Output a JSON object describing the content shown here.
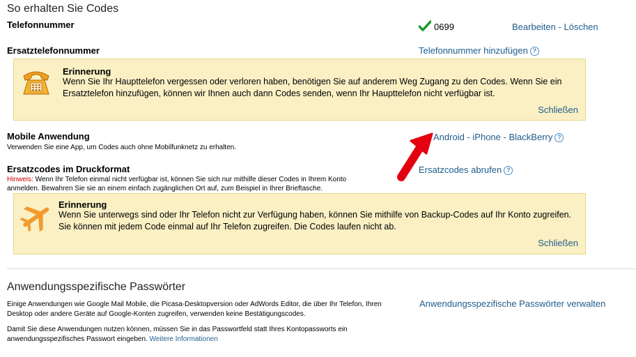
{
  "header": {
    "title": "So erhalten Sie Codes"
  },
  "phone": {
    "label": "Telefonnummer",
    "number": "0699",
    "edit": "Bearbeiten",
    "sep": "-",
    "delete": "Löschen"
  },
  "backup_phone": {
    "label": "Ersatztelefonnummer",
    "add_link": "Telefonnummer hinzufügen",
    "reminder": {
      "title": "Erinnerung",
      "text": "Wenn Sie Ihr Haupttelefon vergessen oder verloren haben, benötigen Sie auf anderem Weg Zugang zu den Codes. Wenn Sie ein Ersatztelefon hinzufügen, können wir Ihnen auch dann Codes senden, wenn Ihr Haupttelefon nicht verfügbar ist.",
      "close": "Schließen"
    }
  },
  "mobile_app": {
    "label": "Mobile Anwendung",
    "desc": "Verwenden Sie eine App, um Codes auch ohne Mobilfunknetz zu erhalten.",
    "links": [
      "Android",
      "iPhone",
      "BlackBerry"
    ],
    "sep": "-"
  },
  "printed_codes": {
    "label": "Ersatzcodes im Druckformat",
    "hint_label": "Hinweis:",
    "hint_text": " Wenn Ihr Telefon einmal nicht verfügbar ist, können Sie sich nur mithilfe dieser Codes in Ihrem Konto anmelden. Bewahren Sie sie an einem einfach zugänglichen Ort auf, zum Beispiel in Ihrer Brieftasche.",
    "link": "Ersatzcodes abrufen",
    "reminder": {
      "title": "Erinnerung",
      "text": "Wenn Sie unterwegs sind oder Ihr Telefon nicht zur Verfügung haben, können Sie mithilfe von Backup-Codes auf Ihr Konto zugreifen. Sie können mit jedem Code einmal auf Ihr Telefon zugreifen. Die Codes laufen nicht ab.",
      "close": "Schließen"
    }
  },
  "app_passwords": {
    "title": "Anwendungsspezifische Passwörter",
    "para1": "Einige Anwendungen wie Google Mail Mobile, die Picasa-Desktopversion oder AdWords Editor, die über Ihr Telefon, Ihren Desktop oder andere Geräte auf Google-Konten zugreifen, verwenden keine Bestätigungscodes.",
    "para2": "Damit Sie diese Anwendungen nutzen können, müssen Sie in das Passwortfeld statt Ihres Kontopassworts ein anwendungsspezifisches Passwort eingeben.",
    "more_link": "Weitere Informationen",
    "manage_link": "Anwendungsspezifische Passwörter verwalten"
  },
  "help_icon": "?",
  "colors": {
    "link": "#1f5c8b",
    "box_bg": "#faf0c4",
    "warning": "#cc0000",
    "arrow": "#e3000f",
    "icon_orange": "#f39a2e"
  }
}
